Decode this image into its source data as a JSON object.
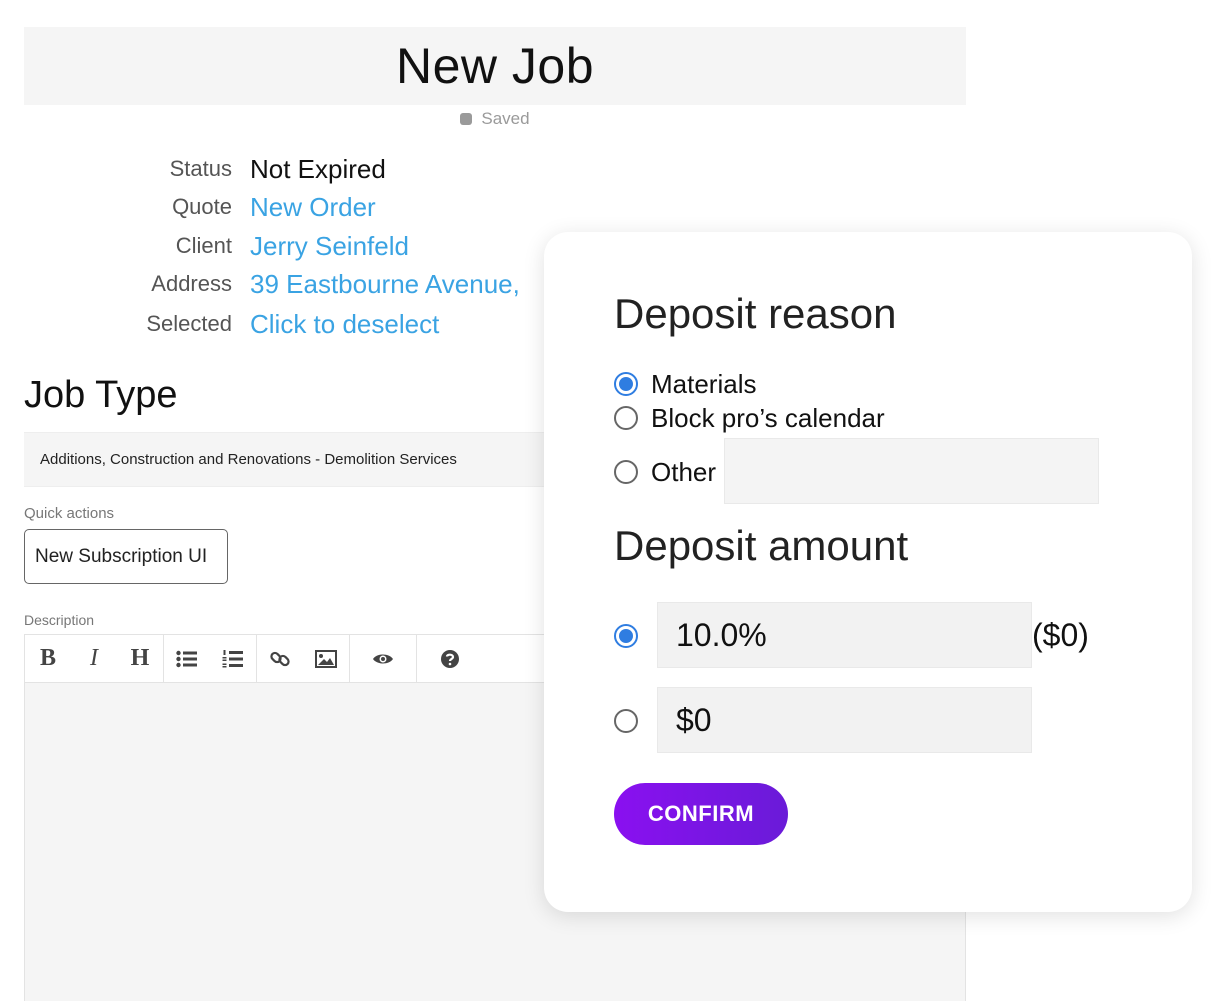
{
  "page": {
    "title": "New Job",
    "saved_status": "Saved"
  },
  "details": [
    {
      "label": "Status",
      "value": "Not Expired"
    },
    {
      "label": "Quote",
      "value": "New Order"
    },
    {
      "label": "Client",
      "value": "Jerry Seinfeld"
    },
    {
      "label": "Address",
      "value": "39 Eastbourne Avenue,"
    },
    {
      "label": "Selected",
      "value": "Click to deselect"
    }
  ],
  "job_type": {
    "heading": "Job Type",
    "value": "Additions, Construction and Renovations - Demolition Services"
  },
  "quick_actions": {
    "label": "Quick actions",
    "button_label": "New Subscription UI"
  },
  "description": {
    "label": "Description",
    "toolbar": {
      "bold": "B",
      "italic": "I",
      "heading": "H"
    }
  },
  "deposit": {
    "reason_heading": "Deposit reason",
    "reasons": [
      {
        "label": "Materials",
        "checked": true
      },
      {
        "label": "Block pro’s calendar",
        "checked": false
      },
      {
        "label": "Other",
        "checked": false
      }
    ],
    "other_value": "",
    "amount_heading": "Deposit amount",
    "percent_value": "10.0%",
    "percent_equivalent": "($0)",
    "fixed_value": "$0",
    "selected_amount_option": "percent",
    "confirm_label": "CONFIRM"
  },
  "colors": {
    "link": "#3aa3e3",
    "radio_checked": "#2f7de1",
    "confirm_start": "#8a10f0",
    "confirm_end": "#6a1bd8"
  }
}
